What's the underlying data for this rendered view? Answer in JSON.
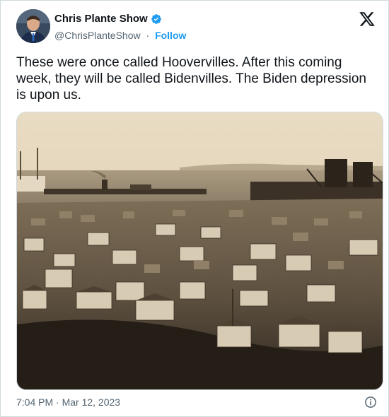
{
  "author": {
    "display_name": "Chris Plante Show",
    "handle": "@ChrisPlanteShow",
    "separator": "·",
    "follow_label": "Follow",
    "verified": true
  },
  "tweet": {
    "text": "These were once called Hoovervilles. After this coming week, they will be called Bidenvilles. The Biden depression is upon us."
  },
  "media": {
    "description_icon": "photo-attachment",
    "tone": "sepia"
  },
  "meta": {
    "timestamp": "7:04 PM · Mar 12, 2023"
  },
  "icons": {
    "brand": "x-logo-icon",
    "info": "info-icon",
    "verified": "verified-badge-icon"
  },
  "colors": {
    "link": "#1d9bf0",
    "text": "#0f1419",
    "secondary": "#536471",
    "border": "#cfd9de"
  }
}
